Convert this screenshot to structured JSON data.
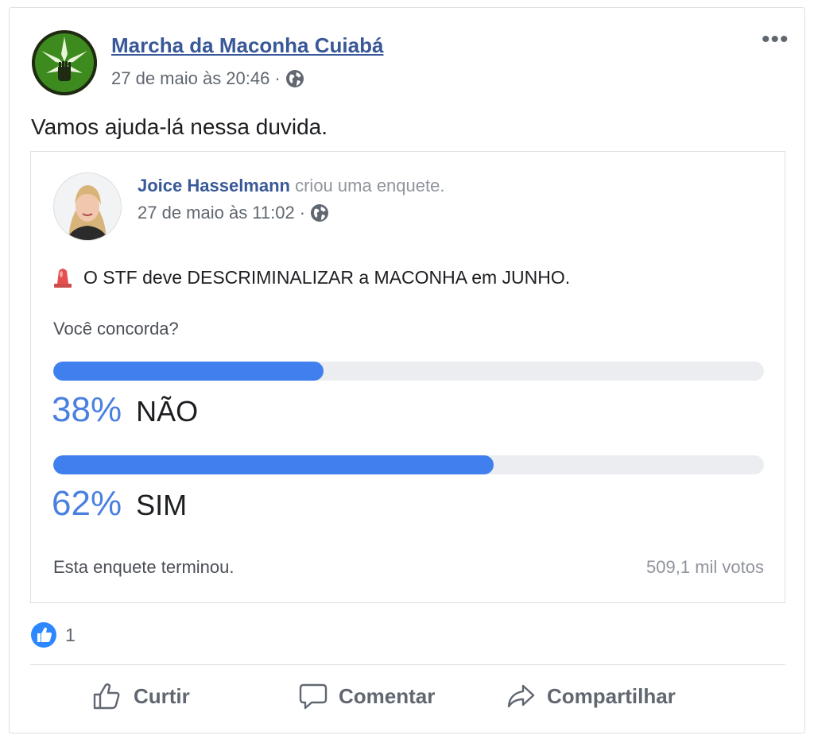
{
  "post": {
    "page_name": "Marcha da Maconha Cuiabá",
    "timestamp": "27 de maio às 20:46",
    "separator": "·",
    "privacy_icon": "globe-icon",
    "more_label": "•••",
    "text": "Vamos ajuda-lá nessa duvida."
  },
  "shared_poll": {
    "author_name": "Joice Hasselmann",
    "author_action": "criou uma enquete.",
    "timestamp": "27 de maio às 11:02",
    "separator": "·",
    "statement": "O STF deve DESCRIMINALIZAR a MACONHA em JUNHO.",
    "question": "Você concorda?",
    "options": [
      {
        "percent_label": "38%",
        "label": "NÃO",
        "fraction": 0.38
      },
      {
        "percent_label": "62%",
        "label": "SIM",
        "fraction": 0.62
      }
    ],
    "status": "Esta enquete terminou.",
    "votes": "509,1 mil votos"
  },
  "reactions": {
    "icon": "like-icon",
    "count": "1"
  },
  "actions": {
    "like": "Curtir",
    "comment": "Comentar",
    "share": "Compartilhar"
  },
  "colors": {
    "link": "#385898",
    "poll_fill": "#4080ee",
    "poll_track": "#ebedf0",
    "percent": "#4a80e0",
    "logo_green": "#3d8a1f"
  }
}
